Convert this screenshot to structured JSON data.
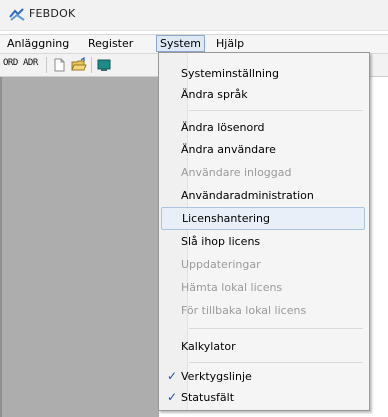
{
  "window": {
    "title": "FEBDOK"
  },
  "menubar": {
    "items": [
      {
        "label": "Anläggning"
      },
      {
        "label": "Register"
      },
      {
        "label": "System"
      },
      {
        "label": "Hjälp"
      }
    ]
  },
  "toolbar": {
    "ord_label": "ORD",
    "adr_label": "ADR"
  },
  "system_menu": {
    "items": [
      {
        "label": "Systeminställning",
        "enabled": true
      },
      {
        "label": "Ändra språk",
        "enabled": true
      },
      {
        "label": "Ändra lösenord",
        "enabled": true
      },
      {
        "label": "Ändra användare",
        "enabled": true
      },
      {
        "label": "Användare inloggad",
        "enabled": false
      },
      {
        "label": "Användaradministration",
        "enabled": true
      },
      {
        "label": "Licenshantering",
        "enabled": true,
        "highlighted": true
      },
      {
        "label": "Slå ihop licens",
        "enabled": true
      },
      {
        "label": "Uppdateringar",
        "enabled": false
      },
      {
        "label": "Hämta lokal licens",
        "enabled": false
      },
      {
        "label": "För tillbaka lokal licens",
        "enabled": false
      },
      {
        "label": "Kalkylator",
        "enabled": true
      },
      {
        "label": "Verktygslinje",
        "enabled": true,
        "checked": true
      },
      {
        "label": "Statusfält",
        "enabled": true,
        "checked": true
      }
    ]
  },
  "colors": {
    "workspace": "#adadad",
    "check": "#1f4fa8",
    "disabled_text": "#9a9a9a",
    "highlight": "#e8eff8"
  }
}
